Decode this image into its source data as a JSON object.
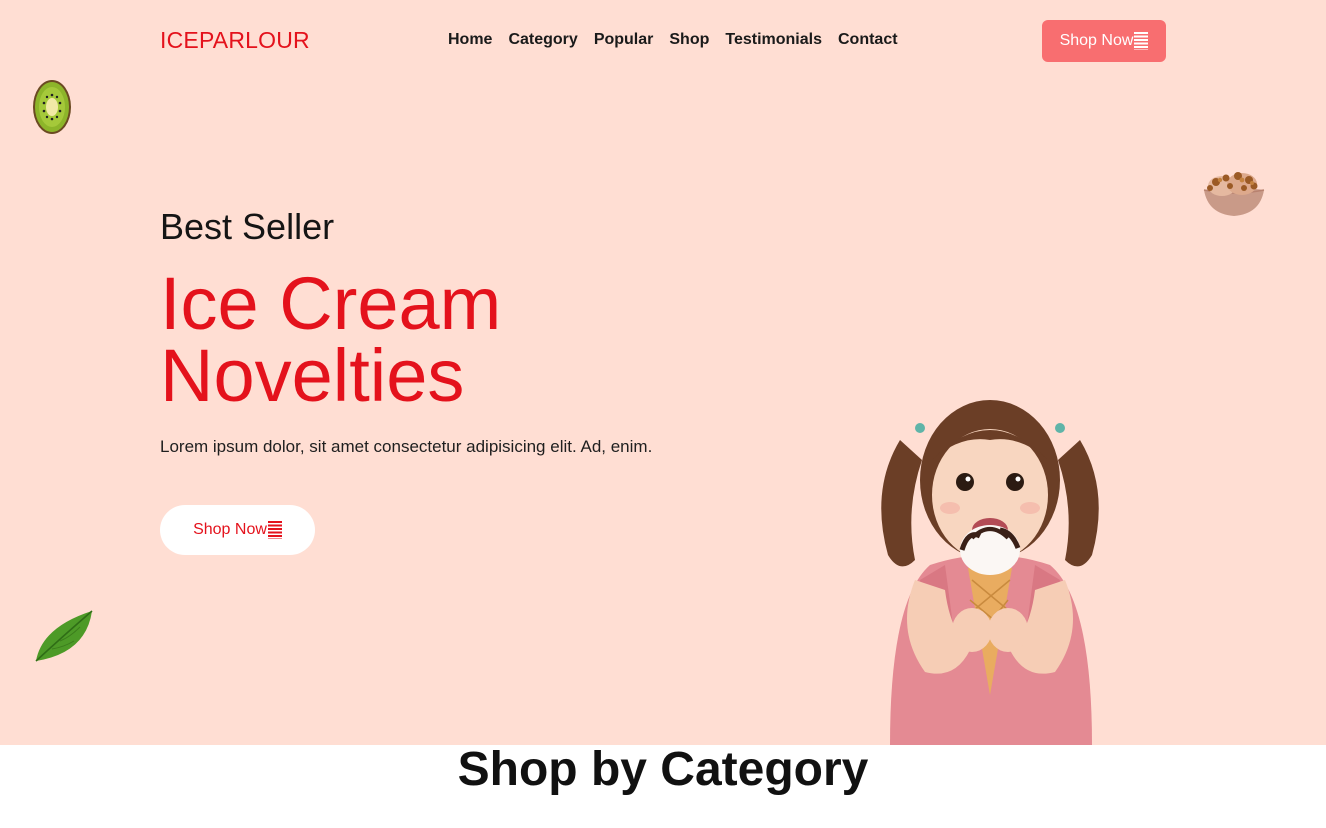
{
  "header": {
    "brand": "ICEPARLOUR",
    "nav": [
      "Home",
      "Category",
      "Popular",
      "Shop",
      "Testimonials",
      "Contact"
    ],
    "cta_label": "Shop Now"
  },
  "hero": {
    "eyebrow": "Best Seller",
    "headline_line1": "Ice Cream",
    "headline_line2": "Novelties",
    "description": "Lorem ipsum dolor, sit amet consectetur adipisicing elit. Ad, enim.",
    "cta_label": "Shop Now"
  },
  "section": {
    "title": "Shop by Category"
  },
  "icons": {
    "cart": "cart-icon",
    "kiwi": "kiwi-image",
    "bowl": "ice-cream-bowl-image",
    "leaf": "leaf-image",
    "girl": "girl-eating-ice-cream-image"
  },
  "colors": {
    "hero_bg": "#ffded3",
    "accent_red": "#e4121c",
    "button_coral": "#f86e70",
    "white": "#ffffff"
  }
}
